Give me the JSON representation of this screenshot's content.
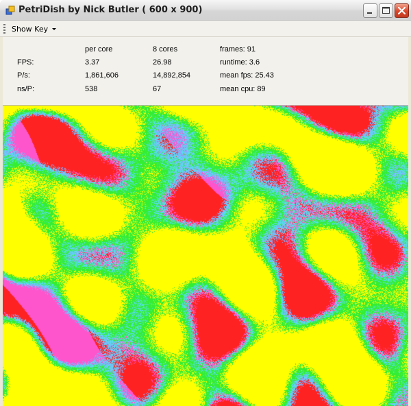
{
  "window": {
    "title": "PetriDish by Nick Butler  ( 600 x 900)",
    "controls": [
      "minimize-icon",
      "maximize-icon",
      "close-icon"
    ]
  },
  "toolbar": {
    "show_key_label": "Show Key"
  },
  "stats": {
    "col_headers": [
      "per core",
      "8 cores"
    ],
    "rows": [
      {
        "label": "FPS:",
        "per_core": "3.37",
        "cores": "26.98",
        "info": "frames: 91"
      },
      {
        "label": "P/s:",
        "per_core": "1,861,606",
        "cores": "14,892,854",
        "info": "runtime: 3.6"
      },
      {
        "label": "ns/P:",
        "per_core": "538",
        "cores": "67",
        "info": "mean fps: 25.43"
      },
      {
        "label": "",
        "per_core": "",
        "cores": "",
        "info": "mean cpu: 89"
      }
    ]
  },
  "colors": {
    "yellow": "#ffff00",
    "green": "#33ee33",
    "cyan": "#55ddee",
    "blue": "#88aaff",
    "magenta": "#ff55cc",
    "red": "#ff2222"
  }
}
